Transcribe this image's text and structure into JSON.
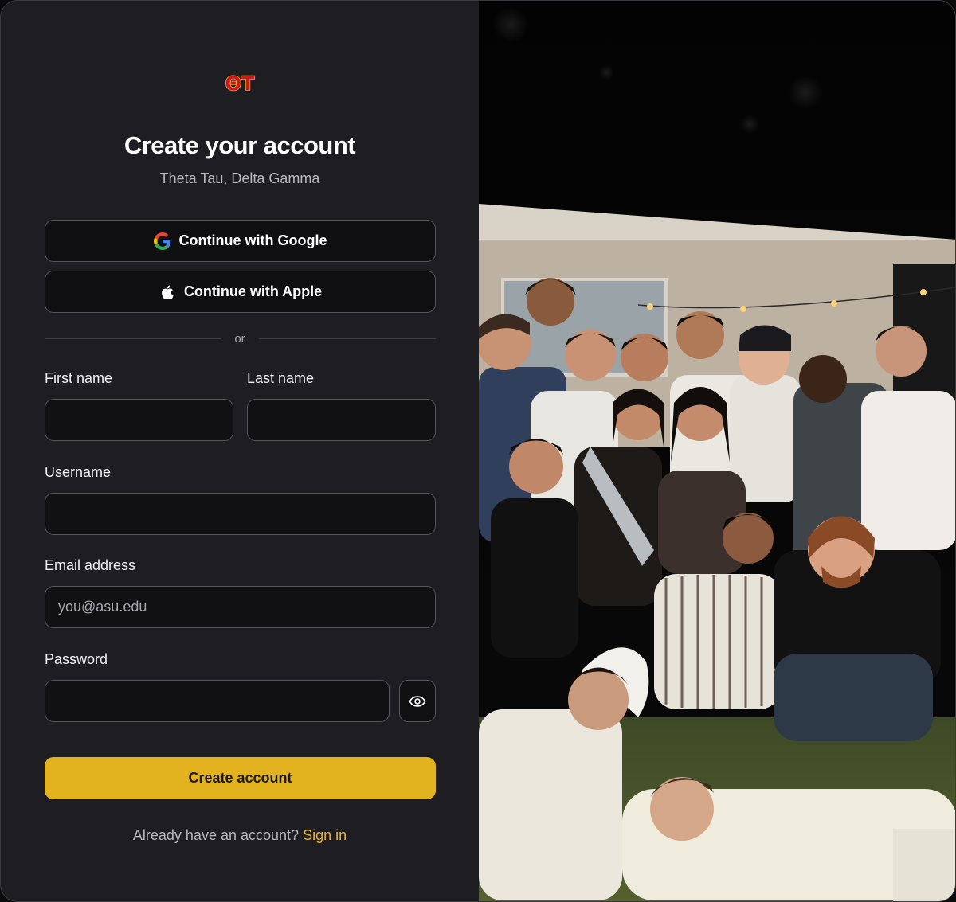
{
  "brand": {
    "logo_text": "ΘT",
    "accent_color": "#e3b31f"
  },
  "header": {
    "title": "Create your account",
    "subtitle": "Theta Tau, Delta Gamma"
  },
  "oauth": {
    "google_label": "Continue with Google",
    "apple_label": "Continue with Apple"
  },
  "divider": {
    "text": "or"
  },
  "form": {
    "first_name": {
      "label": "First name",
      "value": "",
      "placeholder": ""
    },
    "last_name": {
      "label": "Last name",
      "value": "",
      "placeholder": ""
    },
    "username": {
      "label": "Username",
      "value": "",
      "placeholder": ""
    },
    "email": {
      "label": "Email address",
      "value": "",
      "placeholder": "you@asu.edu"
    },
    "password": {
      "label": "Password",
      "value": "",
      "placeholder": ""
    },
    "submit_label": "Create account"
  },
  "footer": {
    "prompt": "Already have an account?",
    "sign_in_label": "Sign in"
  },
  "icons": {
    "google": "google-icon",
    "apple": "apple-icon",
    "eye": "eye-icon"
  }
}
